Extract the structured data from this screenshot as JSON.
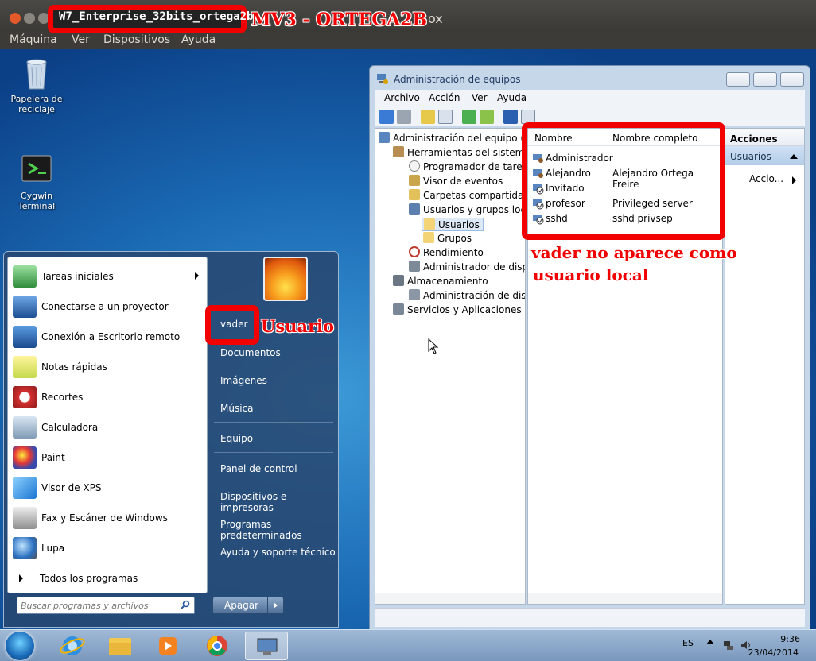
{
  "host": {
    "title_suffix": "Box",
    "menu": [
      "Máquina",
      "Ver",
      "Dispositivos",
      "Ayuda"
    ]
  },
  "desktop_icons": [
    {
      "label": "Papelera de reciclaje",
      "icon": "recycle-bin-icon"
    },
    {
      "label": "Cygwin Terminal",
      "icon": "terminal-icon"
    }
  ],
  "start_menu": {
    "left_items": [
      {
        "label": "Tareas iniciales",
        "icon": "getting-started-icon",
        "submenu": true
      },
      {
        "label": "Conectarse a un proyector",
        "icon": "projector-icon"
      },
      {
        "label": "Conexión a Escritorio remoto",
        "icon": "remote-desktop-icon"
      },
      {
        "label": "Notas rápidas",
        "icon": "sticky-notes-icon"
      },
      {
        "label": "Recortes",
        "icon": "snipping-tool-icon"
      },
      {
        "label": "Calculadora",
        "icon": "calculator-icon"
      },
      {
        "label": "Paint",
        "icon": "paint-icon"
      },
      {
        "label": "Visor de XPS",
        "icon": "xps-viewer-icon"
      },
      {
        "label": "Fax y Escáner de Windows",
        "icon": "fax-scanner-icon"
      },
      {
        "label": "Lupa",
        "icon": "magnifier-icon"
      }
    ],
    "all_programs": "Todos los programas",
    "search_placeholder": "Buscar programas y archivos",
    "right_items": [
      "vader",
      "Documentos",
      "Imágenes",
      "Música",
      "Equipo",
      "Panel de control",
      "Dispositivos e impresoras",
      "Programas predeterminados",
      "Ayuda y soporte técnico"
    ],
    "shutdown": "Apagar"
  },
  "cm_window": {
    "title": "Administración de equipos",
    "menu": [
      "Archivo",
      "Acción",
      "Ver",
      "Ayuda"
    ],
    "tree": [
      {
        "label": "Administración del equipo (lo",
        "level": 0
      },
      {
        "label": "Herramientas del sistema",
        "level": 1
      },
      {
        "label": "Programador de tareas",
        "level": 2
      },
      {
        "label": "Visor de eventos",
        "level": 2
      },
      {
        "label": "Carpetas compartidas",
        "level": 2
      },
      {
        "label": "Usuarios y grupos loca",
        "level": 2
      },
      {
        "label": "Usuarios",
        "level": 3
      },
      {
        "label": "Grupos",
        "level": 3
      },
      {
        "label": "Rendimiento",
        "level": 2
      },
      {
        "label": "Administrador de dispo",
        "level": 2
      },
      {
        "label": "Almacenamiento",
        "level": 1
      },
      {
        "label": "Administración de disco",
        "level": 2
      },
      {
        "label": "Servicios y Aplicaciones",
        "level": 1
      }
    ],
    "list_columns": [
      "Nombre",
      "Nombre completo"
    ],
    "users": [
      {
        "name": "Administrador",
        "full": ""
      },
      {
        "name": "Alejandro",
        "full": "Alejandro Ortega Freire"
      },
      {
        "name": "Invitado",
        "full": ""
      },
      {
        "name": "profesor",
        "full": "Privileged server"
      },
      {
        "name": "sshd",
        "full": "sshd privsep"
      }
    ],
    "actions_header": "Acciones",
    "actions_section": "Usuarios",
    "actions_more": "Accio..."
  },
  "taskbar": {
    "language": "ES",
    "time": "9:36",
    "date": "23/04/2014"
  },
  "annotations": {
    "vm_name": "W7_Enterprise_32bits_ortega2b",
    "vm_label": "MV3 - ORTEGA2B",
    "user_label": "Usuario",
    "note_line1": "vader no aparece como",
    "note_line2": "usuario local"
  },
  "colors": {
    "annotation_red": "#f20000",
    "desktop_blue": "#1b6bb5"
  }
}
